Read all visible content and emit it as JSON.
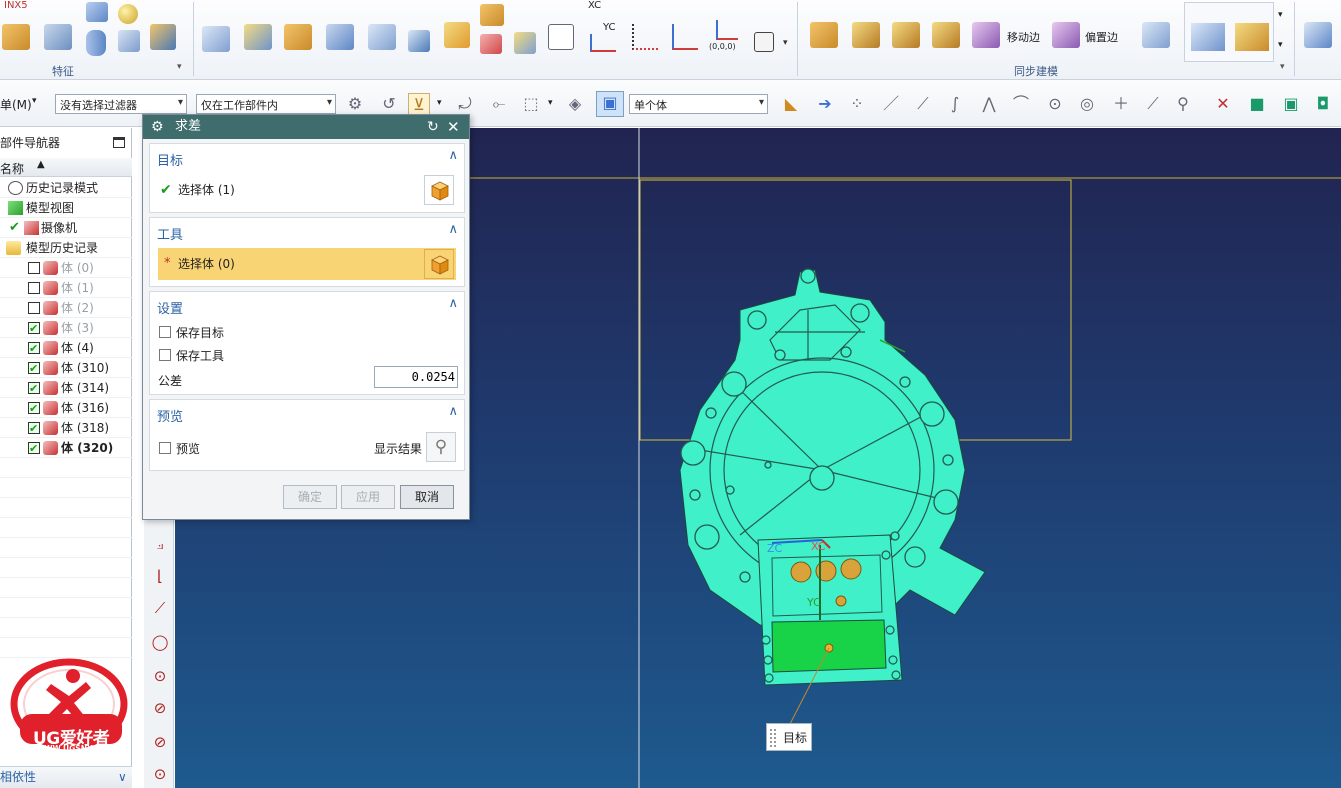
{
  "ribbon": {
    "nx_label": "INX5",
    "group_feature": "特征",
    "group_sync": "同步建模",
    "xc_label": "XC",
    "yc_label": "YC",
    "origin_label": "(0,0,0)",
    "move_edge": "移动边",
    "offset_edge": "偏置边"
  },
  "toolbar": {
    "menu_label": "单(M)",
    "filter_combo": "没有选择过滤器",
    "scope_combo": "仅在工作部件内",
    "body_combo": "单个体"
  },
  "navigator": {
    "title": "部件导航器",
    "column_name": "名称",
    "items": [
      {
        "label": "历史记录模式",
        "type": "clock"
      },
      {
        "label": "模型视图",
        "type": "views"
      },
      {
        "label": "摄像机",
        "type": "camera"
      },
      {
        "label": "模型历史记录",
        "type": "folder"
      },
      {
        "label": "体 (0)",
        "checked": false,
        "grey": true
      },
      {
        "label": "体 (1)",
        "checked": false,
        "grey": true
      },
      {
        "label": "体 (2)",
        "checked": false,
        "grey": true
      },
      {
        "label": "体 (3)",
        "checked": true,
        "grey": true
      },
      {
        "label": "体 (4)",
        "checked": true,
        "grey": false
      },
      {
        "label": "体 (310)",
        "checked": true,
        "grey": false
      },
      {
        "label": "体 (314)",
        "checked": true,
        "grey": false
      },
      {
        "label": "体 (316)",
        "checked": true,
        "grey": false
      },
      {
        "label": "体 (318)",
        "checked": true,
        "grey": false
      },
      {
        "label": "体 (320)",
        "checked": true,
        "grey": false,
        "bold": true
      }
    ],
    "bottom_panel": "相依性"
  },
  "dialog": {
    "title": "求差",
    "target": {
      "heading": "目标",
      "select_label": "选择体 (1)"
    },
    "tool": {
      "heading": "工具",
      "select_label": "选择体 (0)"
    },
    "settings": {
      "heading": "设置",
      "keep_target": "保存目标",
      "keep_tool": "保存工具",
      "tolerance_label": "公差",
      "tolerance_value": "0.0254"
    },
    "preview": {
      "heading": "预览",
      "preview_label": "预览",
      "show_result": "显示结果"
    },
    "buttons": {
      "ok": "确定",
      "apply": "应用",
      "cancel": "取消"
    }
  },
  "viewport": {
    "label_zc": "ZC",
    "label_xc": "XC",
    "label_yc": "YC",
    "tooltip": "目标"
  },
  "watermark": {
    "brand": "UG爱好者",
    "url": "WWW.UGSNX.COM"
  },
  "colors": {
    "part_fill": "#3ff0c8",
    "selected_green": "#18d248",
    "title_bar": "#3f6c6c",
    "tool_highlight": "#f9d474",
    "viewport_top": "#212450",
    "viewport_bottom": "#1e5a8e"
  }
}
